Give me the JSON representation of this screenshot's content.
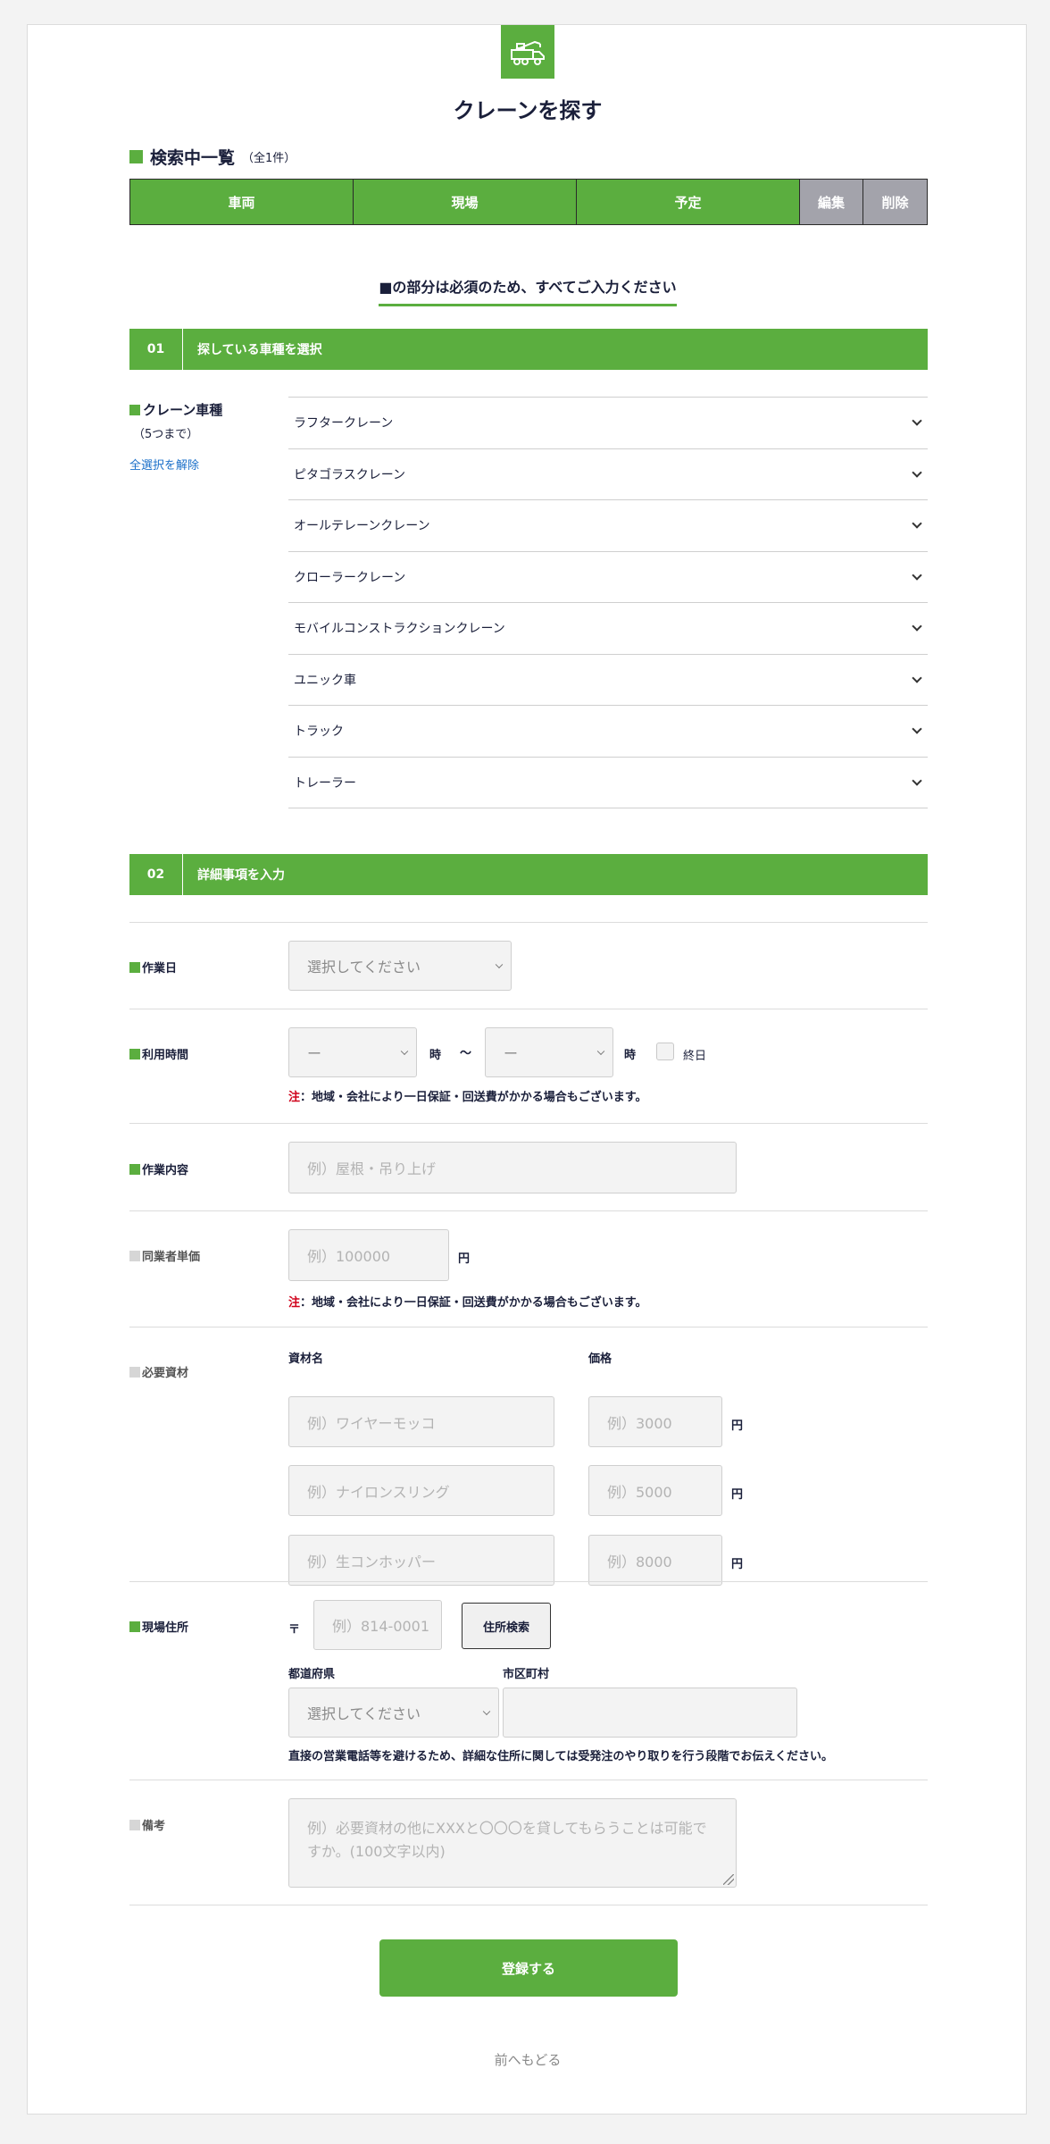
{
  "header": {
    "title": "クレーンを探す",
    "logo_icon": "crane-truck-icon"
  },
  "search_list": {
    "heading": "検索中一覧",
    "count": "（全1件）",
    "columns": [
      "車両",
      "現場",
      "予定"
    ],
    "edit_label": "編集",
    "delete_label": "削除"
  },
  "required_note": "■の部分は必須のため、すべてご入力ください",
  "section1": {
    "num": "01",
    "label": "探している車種を選択"
  },
  "crane_type": {
    "label": "クレーン車種",
    "sub": "（5つまで）",
    "reset": "全選択を解除",
    "items": [
      {
        "label": "ラフタークレーン"
      },
      {
        "label": "ピタゴラスクレーン"
      },
      {
        "label": "オールテレーンクレーン"
      },
      {
        "label": "クローラークレーン"
      },
      {
        "label": "モバイルコンストラクションクレーン"
      },
      {
        "label": "ユニック車"
      },
      {
        "label": "トラック"
      },
      {
        "label": "トレーラー"
      }
    ]
  },
  "section2": {
    "num": "02",
    "label": "詳細事項を入力"
  },
  "form": {
    "work_date": {
      "label": "作業日",
      "placeholder": "選択してください"
    },
    "usage_time": {
      "label": "利用時間",
      "start_value": "ー",
      "end_value": "ー",
      "hour_unit": "時",
      "tilde": "〜",
      "all_day_label": "終日",
      "note_prefix": "注",
      "note_text": "：地域・会社により一日保証・回送費がかかる場合もございます。"
    },
    "work_content": {
      "label": "作業内容",
      "placeholder": "例）屋根・吊り上げ"
    },
    "unit_price": {
      "label": "同業者単価",
      "placeholder": "例）100000",
      "unit": "円",
      "note_prefix": "注",
      "note_text": "：地域・会社により一日保証・回送費がかかる場合もございます。"
    },
    "materials": {
      "label": "必要資材",
      "name_header": "資材名",
      "price_header": "価格",
      "unit": "円",
      "rows": [
        {
          "name_placeholder": "例）ワイヤーモッコ",
          "price_placeholder": "例）3000"
        },
        {
          "name_placeholder": "例）ナイロンスリング",
          "price_placeholder": "例）5000"
        },
        {
          "name_placeholder": "例）生コンホッパー",
          "price_placeholder": "例）8000"
        }
      ]
    },
    "address": {
      "label": "現場住所",
      "postal_mark": "〒",
      "postal_placeholder": "例）814-0001",
      "search_button": "住所検索",
      "pref_label": "都道府県",
      "pref_placeholder": "選択してください",
      "city_label": "市区町村",
      "note": "直接の営業電話等を避けるため、詳細な住所に関しては受発注のやり取りを行う段階でお伝えください。"
    },
    "remarks": {
      "label": "備考",
      "placeholder": "例）必要資材の他にXXXと〇〇〇を貸してもらうことは可能ですか。(100文字以内)"
    }
  },
  "submit_label": "登録する",
  "back_label": "前へもどる",
  "colors": {
    "accent": "#5bae3f",
    "gray_button": "#a3a3ab",
    "note_red": "#d0021b",
    "link": "#1a6fc9"
  }
}
